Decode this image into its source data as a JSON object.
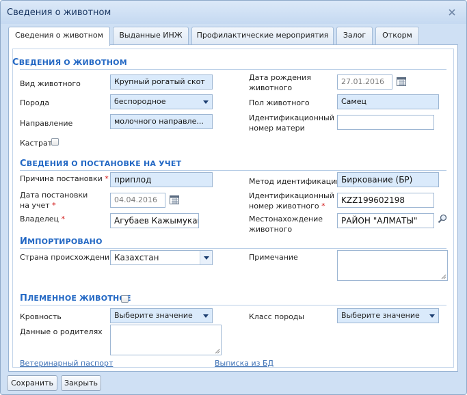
{
  "window": {
    "title": "Сведения о животном"
  },
  "tabs": [
    {
      "label": "Сведения о животном"
    },
    {
      "label": "Выданные ИНЖ"
    },
    {
      "label": "Профилактические мероприятия"
    },
    {
      "label": "Залог"
    },
    {
      "label": "Откорм"
    }
  ],
  "sections": {
    "animal": {
      "cap": "С",
      "rest": "ВЕДЕНИЯ О ЖИВОТНОМ"
    },
    "registration": {
      "cap": "С",
      "rest": "ВЕДЕНИЯ О ПОСТАНОВКЕ НА УЧЕТ"
    },
    "imported": {
      "cap": "И",
      "rest": "МПОРТИРОВАНО"
    },
    "breeding": {
      "cap": "П",
      "rest": "ЛЕМЕННОЕ ЖИВОТНОЕ"
    }
  },
  "animal": {
    "type_label": "Вид животного",
    "type_value": "Крупный рогатый скот",
    "breed_label": "Порода",
    "breed_value": "беспородное",
    "direction_label": "Направление",
    "direction_value": "молочного направле...",
    "castrated_label": "Кастрат",
    "birth_date_label_1": "Дата рождения",
    "birth_date_label_2": "животного",
    "birth_date_value": "27.01.2016",
    "sex_label": "Пол животного",
    "sex_value": "Самец",
    "mother_id_label_1": "Идентификационный",
    "mother_id_label_2": "номер матери",
    "mother_id_value": ""
  },
  "registration": {
    "reason_label": "Причина постановки",
    "reason_value": "приплод",
    "date_label_1": "Дата постановки",
    "date_label_2": "на учет",
    "date_value": "04.04.2016",
    "owner_label": "Владелец",
    "owner_value": "Агубаев Кажымукан",
    "method_label": "Метод идентификации",
    "method_value": "Биркование (БР)",
    "id_label_1": "Идентификационный",
    "id_label_2": "номер животного",
    "id_value": "KZZ199602198",
    "location_label_1": "Местонахождение",
    "location_label_2": "животного",
    "location_value": "РАЙОН \"АЛМАТЫ\""
  },
  "imported": {
    "country_label": "Страна происхождения",
    "country_value": "Казахстан",
    "note_label": "Примечание"
  },
  "breeding": {
    "blood_label": "Кровность",
    "blood_value": "Выберите значение",
    "class_label": "Класс породы",
    "class_value": "Выберите значение",
    "parents_label": "Данные о родителях"
  },
  "links": {
    "vet_passport": "Ветеринарный паспорт",
    "db_extract": "Выписка из БД"
  },
  "buttons": {
    "save": "Сохранить",
    "close": "Закрыть"
  },
  "required_mark": "*",
  "colors": {
    "section_title": "#2368c4",
    "required": "#d01010",
    "field_highlight": "#daeafb",
    "window_bg": "#cfe0f4"
  }
}
